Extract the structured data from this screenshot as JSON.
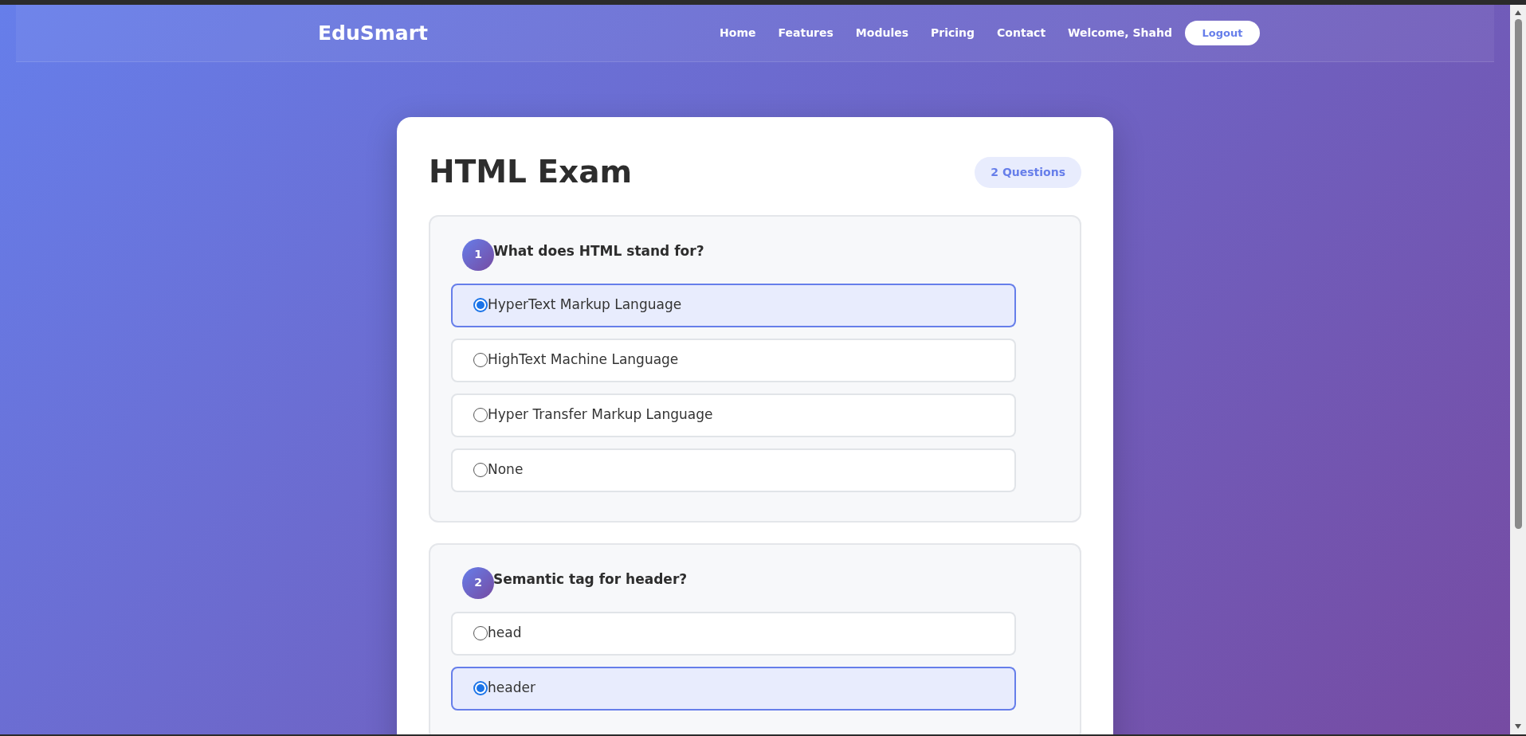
{
  "navbar": {
    "brand": "EduSmart",
    "links": [
      "Home",
      "Features",
      "Modules",
      "Pricing",
      "Contact"
    ],
    "welcome": "Welcome, Shahd",
    "logout": "Logout"
  },
  "exam": {
    "title": "HTML Exam",
    "count": "2 Questions",
    "questions": [
      {
        "number": "1",
        "text": "What does HTML stand for?",
        "options": [
          {
            "label": "HyperText Markup Language",
            "selected": true
          },
          {
            "label": "HighText Machine Language",
            "selected": false
          },
          {
            "label": "Hyper Transfer Markup Language",
            "selected": false
          },
          {
            "label": "None",
            "selected": false
          }
        ]
      },
      {
        "number": "2",
        "text": "Semantic tag for header?",
        "options": [
          {
            "label": "head",
            "selected": false
          },
          {
            "label": "header",
            "selected": true
          }
        ]
      }
    ]
  }
}
